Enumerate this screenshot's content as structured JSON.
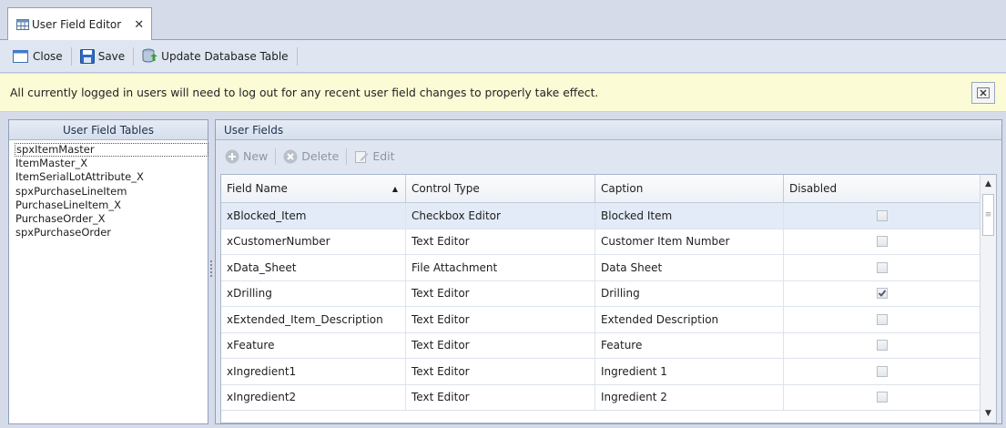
{
  "tab": {
    "label": "User Field Editor",
    "close": "✕"
  },
  "toolbar": {
    "close_label": "Close",
    "save_label": "Save",
    "update_label": "Update Database Table"
  },
  "info": {
    "message": "All currently logged in users will need to log out for any recent user field changes to properly take effect."
  },
  "left_panel": {
    "title": "User Field Tables",
    "items": [
      "spxItemMaster",
      "ItemMaster_X",
      "ItemSerialLotAttribute_X",
      "spxPurchaseLineItem",
      "PurchaseLineItem_X",
      "PurchaseOrder_X",
      "spxPurchaseOrder"
    ],
    "selected_index": 0
  },
  "right_panel": {
    "title": "User Fields",
    "toolbar": {
      "new_label": "New",
      "delete_label": "Delete",
      "edit_label": "Edit"
    },
    "columns": [
      "Field Name",
      "Control Type",
      "Caption",
      "Disabled"
    ],
    "sort_column": "Field Name",
    "rows": [
      {
        "field": "xBlocked_Item",
        "control": "Checkbox Editor",
        "caption": "Blocked Item",
        "disabled": false
      },
      {
        "field": "xCustomerNumber",
        "control": "Text Editor",
        "caption": "Customer Item Number",
        "disabled": false
      },
      {
        "field": "xData_Sheet",
        "control": "File Attachment",
        "caption": "Data Sheet",
        "disabled": false
      },
      {
        "field": "xDrilling",
        "control": "Text Editor",
        "caption": "Drilling",
        "disabled": true
      },
      {
        "field": "xExtended_Item_Description",
        "control": "Text Editor",
        "caption": "Extended Description",
        "disabled": false
      },
      {
        "field": "xFeature",
        "control": "Text Editor",
        "caption": "Feature",
        "disabled": false
      },
      {
        "field": "xIngredient1",
        "control": "Text Editor",
        "caption": "Ingredient 1",
        "disabled": false
      },
      {
        "field": "xIngredient2",
        "control": "Text Editor",
        "caption": "Ingredient 2",
        "disabled": false
      }
    ]
  },
  "colors": {
    "window_bg": "#d6dbe9",
    "info_bg": "#fbfbd6",
    "selected_row": "#e2ebf7",
    "border": "#8ea0bd"
  },
  "icons": [
    "table-icon",
    "close-icon",
    "save-icon",
    "database-update-icon",
    "add-icon",
    "delete-icon",
    "edit-icon",
    "dismiss-icon",
    "sort-ascending-icon",
    "checkbox-icon"
  ]
}
